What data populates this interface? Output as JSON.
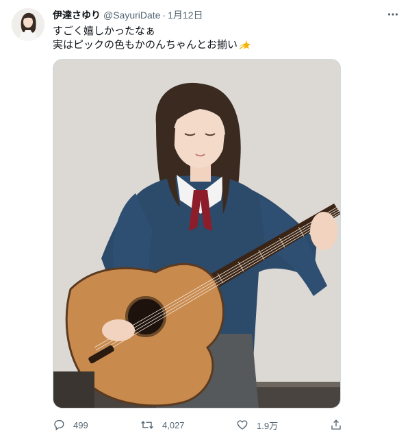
{
  "tweet": {
    "author_name": "伊達さゆり",
    "author_handle": "@SayuriDate",
    "separator": "·",
    "date": "1月12日",
    "text_line1": "すごく嬉しかったなぁ",
    "text_line2": "実はピックの色もかのんちゃんとお揃い",
    "emoji_icon": "sparkles-star-emoji",
    "media_description_icon": "girl-playing-acoustic-guitar-photo"
  },
  "actions": {
    "reply_count": "499",
    "retweet_count": "4,027",
    "like_count": "1.9万"
  },
  "colors": {
    "text": "#0f1419",
    "secondary": "#536471",
    "border": "#cfd9de"
  }
}
